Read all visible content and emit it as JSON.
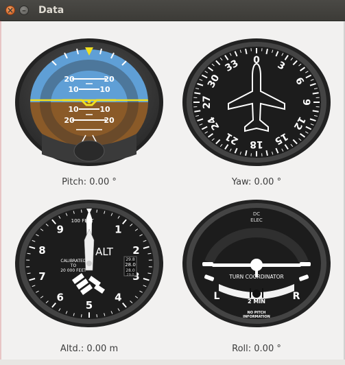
{
  "window": {
    "title": "Data"
  },
  "attitude": {
    "pitch_marks": [
      "20",
      "10",
      "10",
      "20"
    ],
    "label": "Pitch:",
    "value": "0.00",
    "unit": "°"
  },
  "heading": {
    "labels": [
      "0",
      "3",
      "6",
      "9",
      "12",
      "15",
      "18",
      "21",
      "24",
      "27",
      "30",
      "33"
    ],
    "label": "Yaw:",
    "value": "0.00",
    "unit": "°"
  },
  "altimeter": {
    "numbers": [
      "0",
      "1",
      "2",
      "3",
      "4",
      "5",
      "6",
      "7",
      "8",
      "9"
    ],
    "scale_text": "100 FEET",
    "alt_text": "ALT",
    "calibration_text": [
      "CALIBRATED",
      "TO",
      "20 000 FEET"
    ],
    "kollsman": [
      "29.8",
      "28.0",
      "28.0",
      "29.0"
    ],
    "label": "Altd.:",
    "value": "0.00",
    "unit": "m"
  },
  "turn": {
    "power_text": [
      "DC",
      "ELEC"
    ],
    "title": "TURN COORDINATOR",
    "left": "L",
    "right": "R",
    "min_text": "2 MIN",
    "info_text": [
      "NO PITCH",
      "INFORMATION"
    ],
    "label": "Roll:",
    "value": "0.00",
    "unit": "°"
  },
  "colors": {
    "sky": "#5f9fd6",
    "ground": "#8a5a28",
    "bezel": "#3a3a3a",
    "yellow": "#f0e020"
  }
}
